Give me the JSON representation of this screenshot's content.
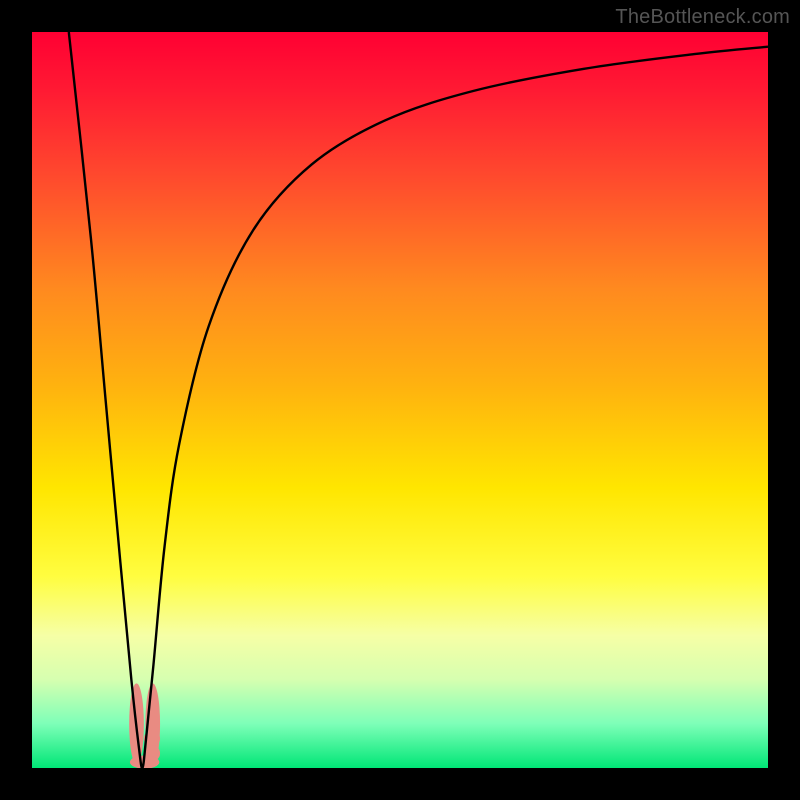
{
  "watermark": "TheBottleneck.com",
  "chart_data": {
    "type": "line",
    "title": "",
    "xlabel": "",
    "ylabel": "",
    "xlim": [
      0,
      100
    ],
    "ylim": [
      0,
      100
    ],
    "grid": false,
    "legend": false,
    "series": [
      {
        "name": "bottleneck-curve",
        "x": [
          5,
          8,
          10,
          12,
          13.5,
          14.5,
          15,
          15.5,
          16.5,
          18,
          20,
          24,
          30,
          38,
          48,
          60,
          75,
          90,
          100
        ],
        "y": [
          100,
          72,
          50,
          28,
          12,
          3,
          0,
          4,
          14,
          30,
          44,
          60,
          73,
          82,
          88,
          92,
          95,
          97,
          98
        ]
      }
    ],
    "background_gradient": {
      "stops": [
        {
          "pos": 0.0,
          "color": "#ff0033"
        },
        {
          "pos": 0.08,
          "color": "#ff1a33"
        },
        {
          "pos": 0.2,
          "color": "#ff4b2d"
        },
        {
          "pos": 0.35,
          "color": "#ff8a1f"
        },
        {
          "pos": 0.48,
          "color": "#ffb20f"
        },
        {
          "pos": 0.62,
          "color": "#ffe600"
        },
        {
          "pos": 0.74,
          "color": "#fffd40"
        },
        {
          "pos": 0.82,
          "color": "#f6ffa6"
        },
        {
          "pos": 0.88,
          "color": "#d6ffb0"
        },
        {
          "pos": 0.94,
          "color": "#7dffb8"
        },
        {
          "pos": 1.0,
          "color": "#00e676"
        }
      ]
    },
    "markers": [
      {
        "name": "left-lobe",
        "x": 14.2,
        "y": 6,
        "rx": 1.0,
        "ry": 5.5,
        "color": "#e98b82"
      },
      {
        "name": "right-lobe",
        "x": 16.4,
        "y": 6,
        "rx": 1.0,
        "ry": 5.5,
        "color": "#e98b82"
      },
      {
        "name": "dot-a",
        "x": 16.3,
        "y": 4.0,
        "r": 1.1,
        "color": "#e98b82"
      },
      {
        "name": "dot-b",
        "x": 16.3,
        "y": 2.0,
        "r": 1.1,
        "color": "#e98b82"
      },
      {
        "name": "base",
        "x": 15.3,
        "y": 0.8,
        "rx": 2.0,
        "ry": 0.9,
        "color": "#e98b82"
      }
    ],
    "curve_style": {
      "stroke": "#000000",
      "width": 2.4
    }
  }
}
